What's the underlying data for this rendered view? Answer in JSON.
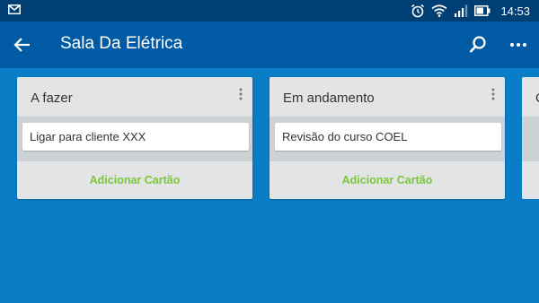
{
  "status_bar": {
    "time": "14:53",
    "icons": [
      "mail-icon",
      "alarm-icon",
      "wifi-icon",
      "signal-icon",
      "battery-icon"
    ]
  },
  "app_bar": {
    "title": "Sala Da Elétrica",
    "icons": [
      "back-arrow-icon",
      "search-icon",
      "more-horizontal-icon"
    ]
  },
  "board": {
    "lists": [
      {
        "name": "A fazer",
        "cards": [
          "Ligar para cliente XXX"
        ],
        "add_label": "Adicionar Cartão"
      },
      {
        "name": "Em andamento",
        "cards": [
          "Revisão do curso COEL"
        ],
        "add_label": "Adicionar Cartão"
      }
    ],
    "partial_list_initial": "C"
  },
  "colors": {
    "background": "#0a7dc7",
    "app_bar": "#005ba4",
    "status_bar": "#003f73",
    "add_card_text": "#7ec73a",
    "list_background": "#e2e4e6"
  }
}
